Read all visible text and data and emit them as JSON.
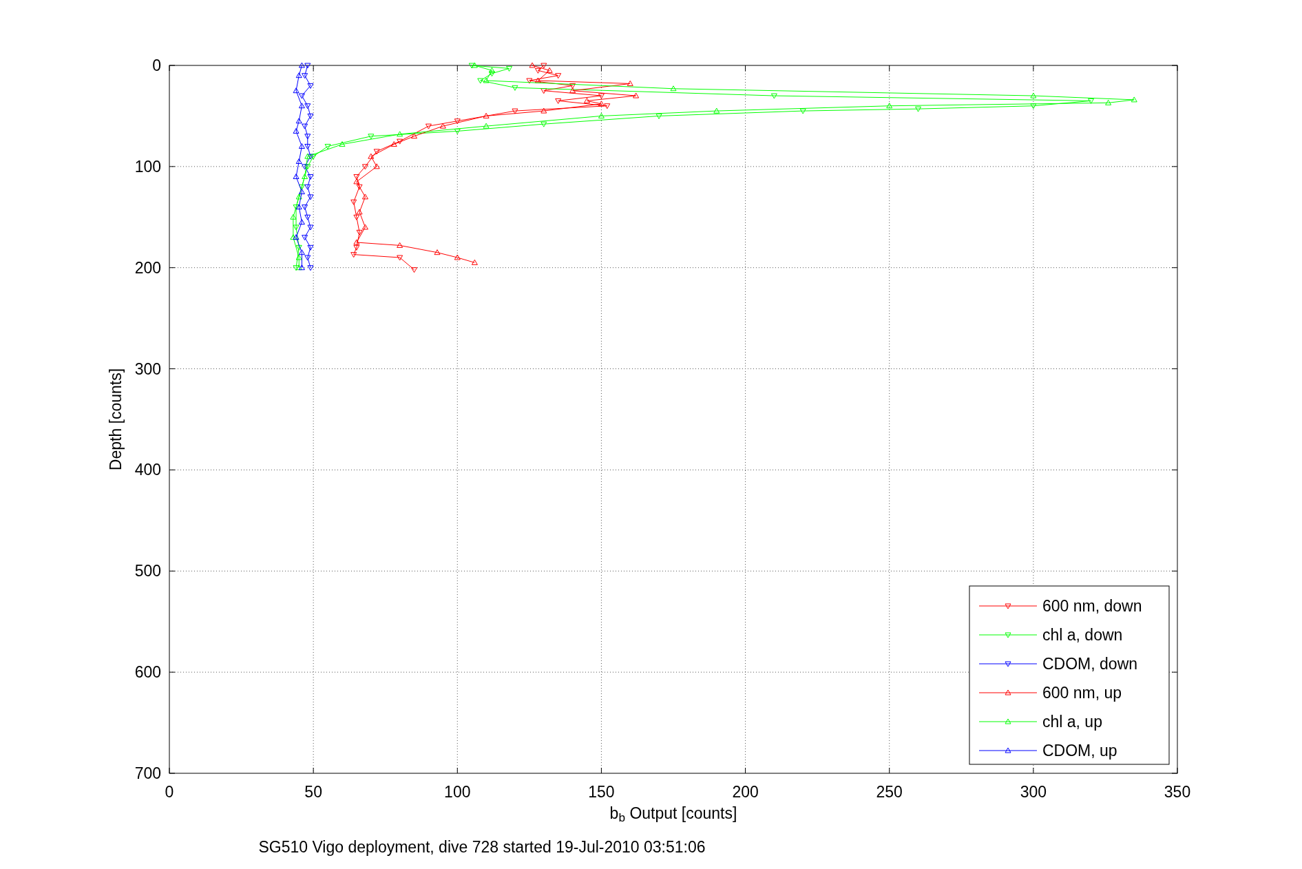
{
  "figure": {
    "caption": "SG510 Vigo deployment, dive 728 started 19-Jul-2010 03:51:06",
    "chart_data": {
      "type": "line",
      "grid": true,
      "legend": true,
      "xlabel": "b$_{b}$ Output [counts]",
      "ylabel": "Depth [counts]",
      "xlim": [
        0,
        350
      ],
      "ylim": [
        700,
        0
      ],
      "xticks": [
        0,
        50,
        100,
        150,
        200,
        250,
        300,
        350
      ],
      "yticks": [
        0,
        100,
        200,
        300,
        400,
        500,
        600,
        700
      ],
      "series": [
        {
          "name": "600 nm, down",
          "color": "#ff0000",
          "marker": "triangle",
          "x": [
            130,
            128,
            135,
            125,
            140,
            130,
            150,
            135,
            152,
            120,
            100,
            90,
            80,
            72,
            68,
            65,
            66,
            64,
            65,
            66,
            65,
            64,
            80,
            85
          ],
          "values": [
            0,
            5,
            10,
            15,
            20,
            25,
            30,
            35,
            40,
            45,
            55,
            60,
            75,
            85,
            100,
            110,
            120,
            135,
            150,
            165,
            180,
            187,
            190,
            202
          ]
        },
        {
          "name": "chl a, down",
          "color": "#00ff00",
          "marker": "triangle",
          "x": [
            105,
            118,
            112,
            108,
            120,
            210,
            320,
            300,
            260,
            220,
            170,
            130,
            100,
            70,
            55,
            50,
            48,
            46,
            44,
            44,
            45,
            44
          ],
          "values": [
            0,
            3,
            8,
            15,
            22,
            30,
            35,
            40,
            43,
            45,
            50,
            58,
            65,
            70,
            80,
            90,
            100,
            120,
            140,
            160,
            180,
            200
          ]
        },
        {
          "name": "CDOM, down",
          "color": "#0000ff",
          "marker": "triangle",
          "x": [
            48,
            47,
            49,
            46,
            48,
            49,
            47,
            48,
            48,
            49,
            47,
            49,
            48,
            49,
            47,
            48,
            49,
            47,
            49,
            48,
            49
          ],
          "values": [
            0,
            10,
            20,
            30,
            40,
            50,
            60,
            70,
            80,
            90,
            100,
            110,
            120,
            130,
            140,
            150,
            160,
            170,
            180,
            190,
            200
          ]
        },
        {
          "name": "600 nm, up",
          "color": "#ff0000",
          "marker": "triangle",
          "x": [
            126,
            132,
            128,
            160,
            140,
            162,
            145,
            150,
            130,
            110,
            95,
            85,
            78,
            70,
            72,
            65,
            68,
            66,
            68,
            65,
            80,
            93,
            100,
            106
          ],
          "values": [
            0,
            5,
            15,
            18,
            25,
            30,
            35,
            38,
            45,
            50,
            60,
            70,
            78,
            90,
            100,
            115,
            130,
            145,
            160,
            175,
            178,
            185,
            190,
            195
          ]
        },
        {
          "name": "chl a, up",
          "color": "#00ff00",
          "marker": "triangle",
          "x": [
            106,
            112,
            110,
            175,
            300,
            335,
            326,
            250,
            190,
            150,
            110,
            80,
            60,
            48,
            47,
            45,
            43,
            43,
            45,
            45
          ],
          "values": [
            0,
            5,
            15,
            23,
            30,
            34,
            37,
            40,
            45,
            50,
            60,
            68,
            78,
            90,
            110,
            130,
            150,
            170,
            190,
            200
          ]
        },
        {
          "name": "CDOM, up",
          "color": "#0000ff",
          "marker": "triangle",
          "x": [
            46,
            45,
            44,
            46,
            45,
            44,
            46,
            45,
            44,
            46,
            45,
            46,
            44,
            46,
            46
          ],
          "values": [
            0,
            10,
            25,
            40,
            55,
            65,
            80,
            95,
            110,
            125,
            140,
            155,
            170,
            185,
            200
          ]
        }
      ]
    }
  }
}
